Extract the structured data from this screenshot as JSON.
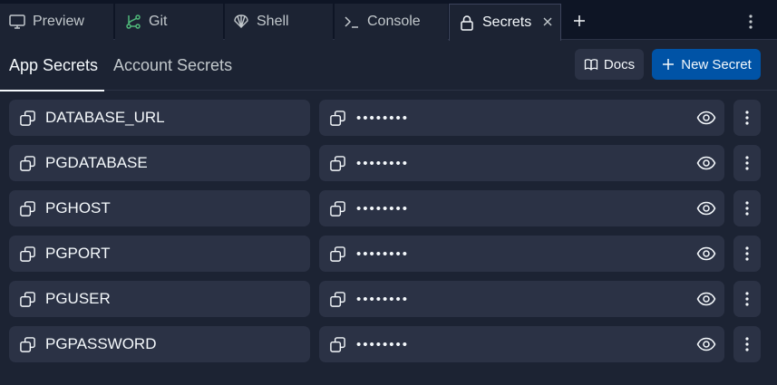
{
  "tabs": [
    {
      "label": "Preview",
      "icon": "monitor-icon"
    },
    {
      "label": "Git",
      "icon": "git-branch-icon"
    },
    {
      "label": "Shell",
      "icon": "shell-icon"
    },
    {
      "label": "Console",
      "icon": "terminal-icon"
    },
    {
      "label": "Secrets",
      "icon": "lock-icon",
      "active": true
    }
  ],
  "header": {
    "app_secrets": "App Secrets",
    "account_secrets": "Account Secrets",
    "docs_label": "Docs",
    "new_secret_label": "New Secret"
  },
  "secrets": [
    {
      "key": "DATABASE_URL",
      "value": "••••••••"
    },
    {
      "key": "PGDATABASE",
      "value": "••••••••"
    },
    {
      "key": "PGHOST",
      "value": "••••••••"
    },
    {
      "key": "PGPORT",
      "value": "••••••••"
    },
    {
      "key": "PGUSER",
      "value": "••••••••"
    },
    {
      "key": "PGPASSWORD",
      "value": "••••••••"
    }
  ],
  "colors": {
    "background": "#1c2333",
    "tabbar": "#0e1525",
    "surface": "#2b3245",
    "primary": "#0053a6",
    "text": "#f5f9fc"
  }
}
